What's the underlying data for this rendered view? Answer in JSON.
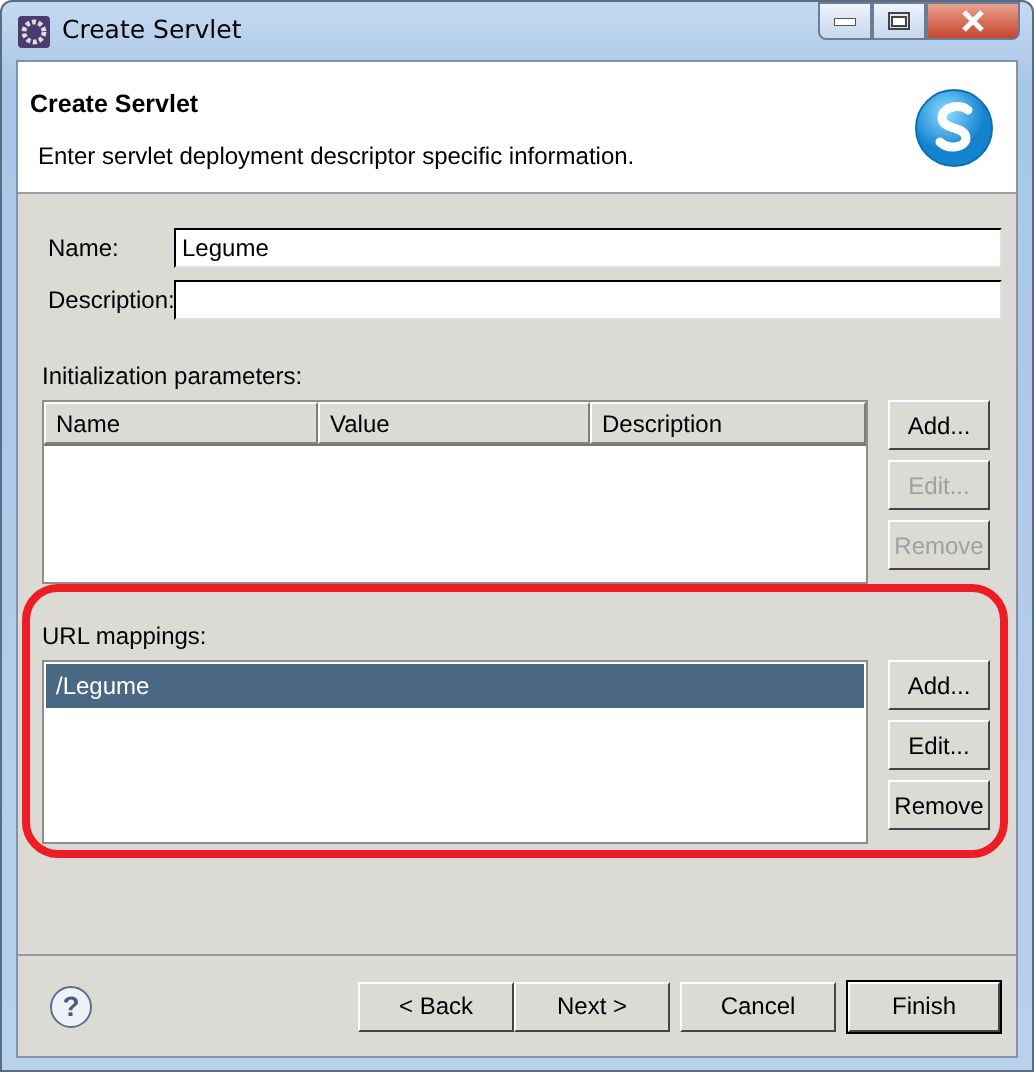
{
  "window": {
    "title": "Create Servlet"
  },
  "header": {
    "title": "Create Servlet",
    "description": "Enter servlet deployment descriptor specific information."
  },
  "fields": [
    {
      "label": "Name:",
      "value": "Legume"
    },
    {
      "label": "Description:"
    }
  ],
  "init_parameters": {
    "label": "Initialization parameters:",
    "columns": [
      "Name",
      "Value",
      "Description"
    ],
    "buttons": [
      {
        "label": "Add...",
        "disabled": false
      },
      {
        "label": "Edit...",
        "disabled": true
      },
      {
        "label": "Remove",
        "disabled": true
      }
    ]
  },
  "url_mappings": {
    "label": "URL mappings:",
    "highlighted": true,
    "rows": [
      {
        "text": "/Legume",
        "selected": true
      }
    ],
    "buttons": [
      {
        "label": "Add...",
        "disabled": false
      },
      {
        "label": "Edit...",
        "disabled": false
      },
      {
        "label": "Remove",
        "disabled": false
      }
    ]
  },
  "help_button": "?",
  "footer_buttons": [
    {
      "label": "< Back",
      "default": false
    },
    {
      "label": "Next >",
      "default": false
    },
    {
      "label": "Cancel",
      "default": false
    },
    {
      "label": "Finish",
      "default": true
    }
  ]
}
